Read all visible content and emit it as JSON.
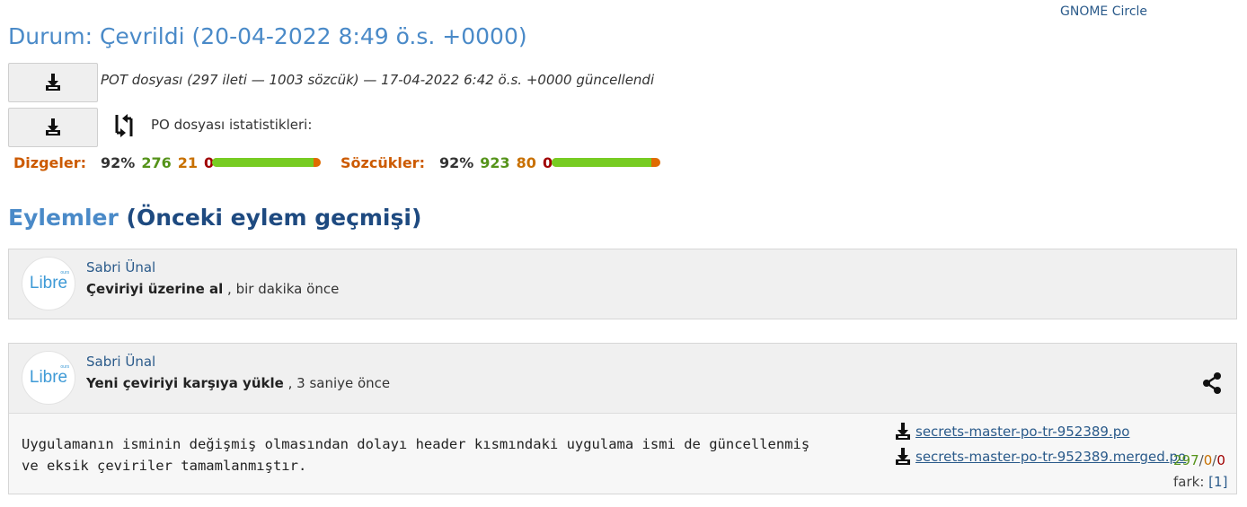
{
  "top_link": "GNOME Circle",
  "status": {
    "heading": "Durum: Çevrildi (20-04-2022 8:49 ö.s. +0000)"
  },
  "pot": {
    "info": "POT dosyası (297 ileti — 1003 sözcük) — 17-04-2022 6:42 ö.s. +0000 güncellendi"
  },
  "po": {
    "label": "PO dosyası istatistikleri:"
  },
  "stats": {
    "strings": {
      "label": "Dizgeler:",
      "percent": "92%",
      "translated": "276",
      "fuzzy": "21",
      "untranslated": "0",
      "progress": 0.93
    },
    "words": {
      "label": "Sözcükler:",
      "percent": "92%",
      "translated": "923",
      "fuzzy": "80",
      "untranslated": "0",
      "progress": 0.92
    }
  },
  "actions": {
    "title": "Eylemler",
    "history_link": "(Önceki eylem geçmişi)"
  },
  "entries": [
    {
      "avatar_text": "Libre",
      "avatar_sup": "ours",
      "user": "Sabri Ünal",
      "action": "Çeviriyi üzerine al",
      "time": ", bir dakika önce"
    },
    {
      "avatar_text": "Libre",
      "avatar_sup": "ours",
      "user": "Sabri Ünal",
      "action": "Yeni çeviriyi karşıya yükle",
      "time": ", 3 saniye önce",
      "comment": "Uygulamanın isminin değişmiş olmasından dolayı header kısmındaki uygulama ismi de güncellenmiş\nve eksik çeviriler tamamlanmıştır.",
      "files": [
        {
          "name": "secrets-master-po-tr-952389.po"
        },
        {
          "name": "secrets-master-po-tr-952389.merged.po"
        }
      ],
      "counts": {
        "translated": "297",
        "fuzzy": "0",
        "untranslated": "0",
        "sep": "/"
      },
      "diff": {
        "label": "fark:",
        "link": "[1]"
      }
    }
  ],
  "colors": {
    "heading": "#4a8ac8",
    "link": "#2a5a8a",
    "translated": "#55931a",
    "fuzzy": "#c87000",
    "untranslated": "#a00000"
  }
}
